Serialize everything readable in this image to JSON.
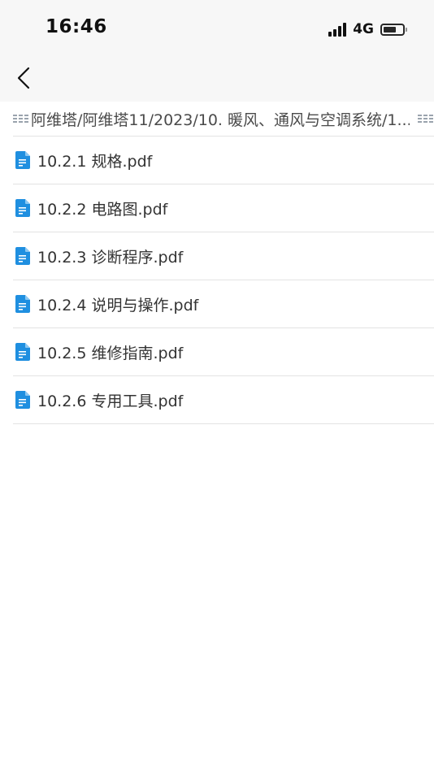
{
  "status_bar": {
    "time": "16:46",
    "network": "4G",
    "signal_bars": 4,
    "battery_level": 0.7
  },
  "nav": {
    "back_icon": "chevron-left-icon"
  },
  "breadcrumb": {
    "path_text": "阿维塔/阿维塔11/2023/10. 暖风、通风与空调系统/1...",
    "icon": "dots-grid-icon"
  },
  "files": [
    {
      "name": "10.2.1 规格.pdf",
      "icon": "document-icon"
    },
    {
      "name": "10.2.2 电路图.pdf",
      "icon": "document-icon"
    },
    {
      "name": "10.2.3 诊断程序.pdf",
      "icon": "document-icon"
    },
    {
      "name": "10.2.4 说明与操作.pdf",
      "icon": "document-icon"
    },
    {
      "name": "10.2.5 维修指南.pdf",
      "icon": "document-icon"
    },
    {
      "name": "10.2.6 专用工具.pdf",
      "icon": "document-icon"
    }
  ],
  "colors": {
    "file_icon": "#1f8fe0",
    "breadcrumb_icon": "#9aa3ad",
    "bar_background": "#f7f7f7",
    "divider": "#e3e3e3"
  }
}
